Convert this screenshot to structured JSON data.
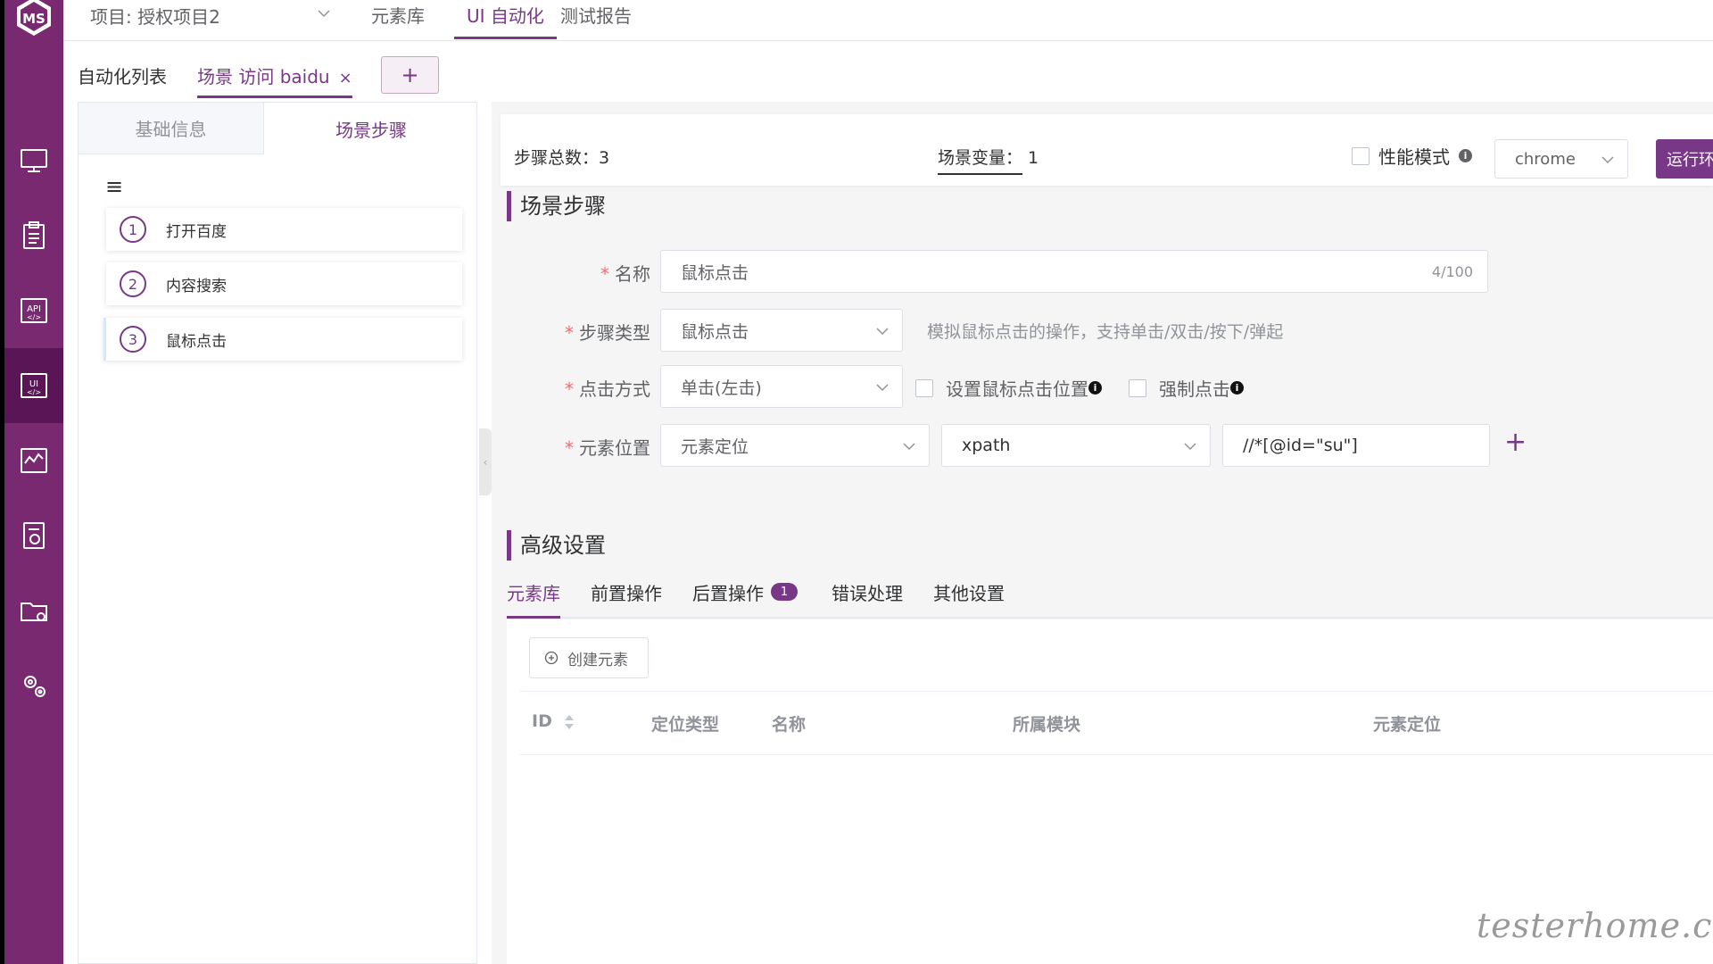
{
  "topbar": {
    "project": "项目: 授权项目2",
    "tabs": [
      "元素库",
      "UI 自动化",
      "测试报告"
    ],
    "active_tab": "UI 自动化"
  },
  "subtabs": {
    "list": "自动化列表",
    "scene": "场景 访问 baidu",
    "close": "×",
    "add": "+"
  },
  "left_panel": {
    "tabs": [
      "基础信息",
      "场景步骤"
    ],
    "menu_icon": "≡",
    "steps": [
      {
        "num": "1",
        "label": "打开百度"
      },
      {
        "num": "2",
        "label": "内容搜索"
      },
      {
        "num": "3",
        "label": "鼠标点击"
      }
    ]
  },
  "summary": {
    "steps_label": "步骤总数：",
    "steps_value": "3",
    "vars_label": "场景变量：",
    "vars_value": "1",
    "perf_mode": "性能模式",
    "browser": "chrome",
    "run_button": "运行环境"
  },
  "scene_steps": {
    "title": "场景步骤",
    "name_label": "名称",
    "name_value": "鼠标点击",
    "name_count": "4/100",
    "type_label": "步骤类型",
    "type_value": "鼠标点击",
    "type_hint": "模拟鼠标点击的操作，支持单击/双击/按下/弹起",
    "click_label": "点击方式",
    "click_value": "单击(左击)",
    "set_pos": "设置鼠标点击位置",
    "force_click": "强制点击",
    "elem_label": "元素位置",
    "elem_mode": "元素定位",
    "elem_type": "xpath",
    "elem_value": "//*[@id=\"su\"]",
    "add": "+"
  },
  "advanced": {
    "title": "高级设置",
    "tabs": [
      "元素库",
      "前置操作",
      "后置操作",
      "错误处理",
      "其他设置"
    ],
    "post_badge": "1",
    "create_button": "创建元素",
    "columns": [
      "ID",
      "定位类型",
      "名称",
      "所属模块",
      "元素定位"
    ]
  },
  "watermark": "testerhome.com"
}
